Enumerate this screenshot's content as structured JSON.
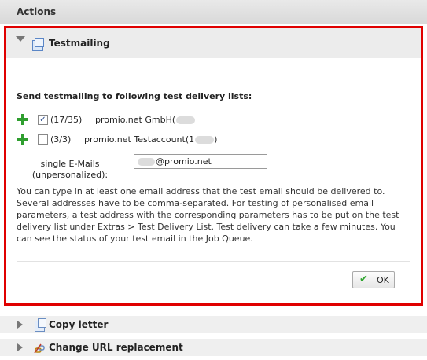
{
  "header": {
    "title": "Actions"
  },
  "testmailing": {
    "title": "Testmailing",
    "intro": "Send testmailing to following test delivery lists:",
    "lists": [
      {
        "count": "(17/35)",
        "name": "promio.net GmbH(",
        "suffix": "",
        "checked": true
      },
      {
        "count": "(3/3)",
        "name": "promio.net Testaccount(1",
        "suffix": ")",
        "checked": false
      }
    ],
    "single_email": {
      "label_line1": "single E-Mails",
      "label_line2": "(unpersonalized):",
      "value": "@promio.net"
    },
    "help_text": "You can type in at least one email address that the test email should be delivered to. Several addresses have to be comma-separated. For testing of personalised email parameters, a test address with the corresponding parameters has to be put on the test delivery list under Extras > Test Delivery List. Test delivery can take a few minutes. You can see the status of your test email in the Job Queue.",
    "ok_label": "OK"
  },
  "sections": [
    {
      "title": "Copy letter",
      "icon": "copy-icon"
    },
    {
      "title": "Change URL replacement",
      "icon": "link-edit-icon"
    }
  ],
  "colors": {
    "highlight_border": "#e00000",
    "plus_green": "#2f9e2f"
  }
}
